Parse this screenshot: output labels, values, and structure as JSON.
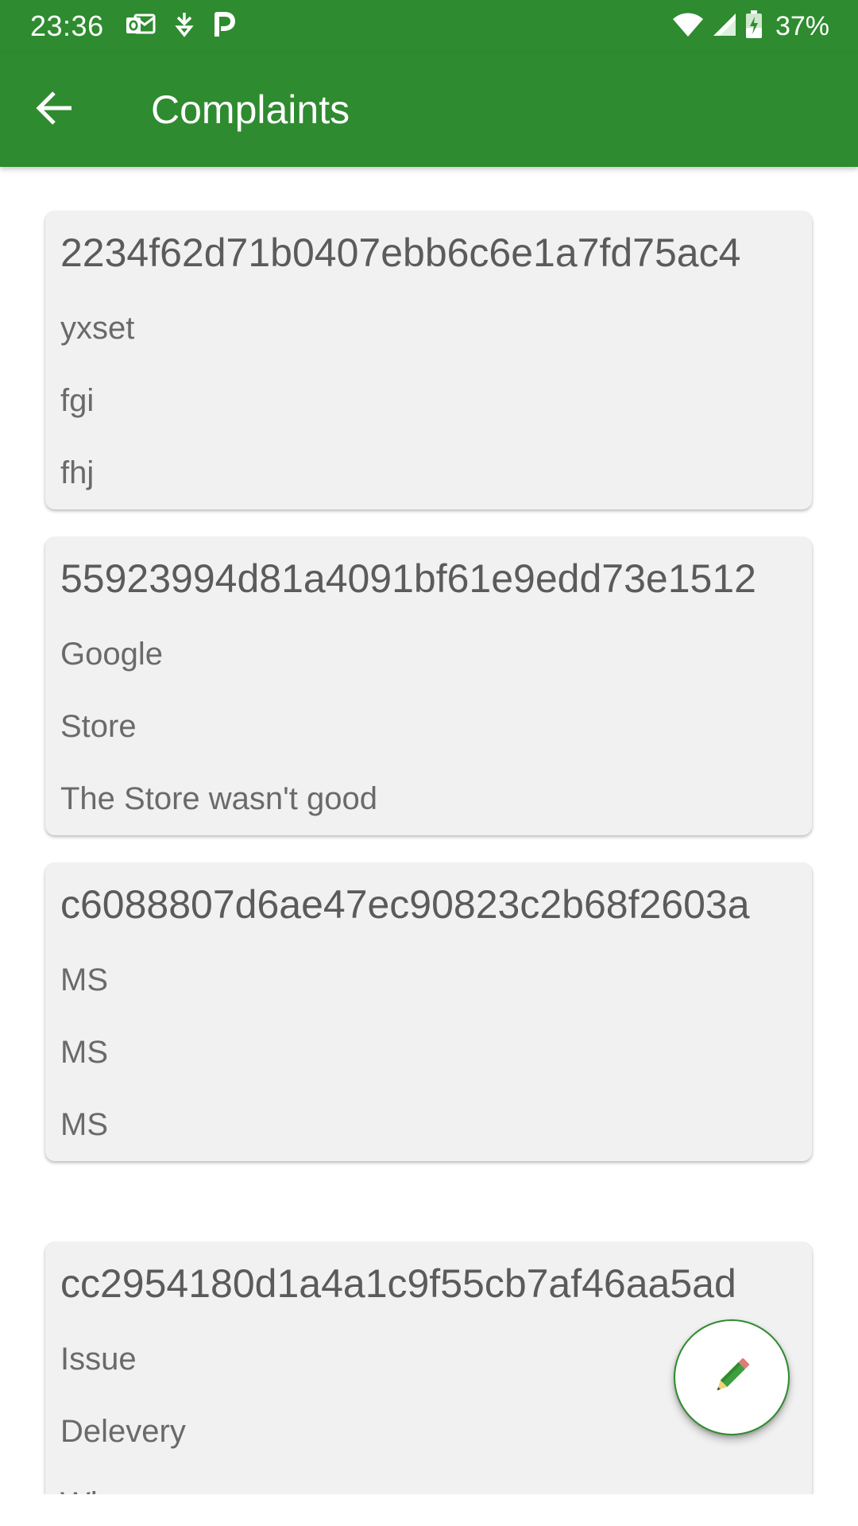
{
  "status_bar": {
    "time": "23:36",
    "battery_percent": "37%",
    "icons_left": [
      "outlook-icon",
      "download-icon",
      "parking-icon"
    ],
    "icons_right": [
      "wifi-icon",
      "signal-icon",
      "battery-charging-icon"
    ]
  },
  "app_bar": {
    "title": "Complaints",
    "back_icon": "arrow-back-icon"
  },
  "complaints": [
    {
      "id": "2234f62d71b0407ebb6c6e1a7fd75ac4",
      "lines": [
        "yxset",
        "fgi",
        "fhj"
      ]
    },
    {
      "id": "55923994d81a4091bf61e9edd73e1512",
      "lines": [
        "Google",
        "Store",
        "The Store wasn't good"
      ]
    },
    {
      "id": "c6088807d6ae47ec90823c2b68f2603a",
      "lines": [
        "MS",
        "MS",
        "MS"
      ]
    },
    {
      "id": "cc2954180d1a4a1c9f55cb7af46aa5ad",
      "lines": [
        "Issue",
        "Delevery",
        "Wh..."
      ]
    }
  ],
  "fab": {
    "icon": "pencil-icon"
  },
  "colors": {
    "primary": "#2e8b2f",
    "card_background": "#f1f1f1",
    "title_text": "#5b5b5b",
    "body_text": "#6a6a6a"
  }
}
